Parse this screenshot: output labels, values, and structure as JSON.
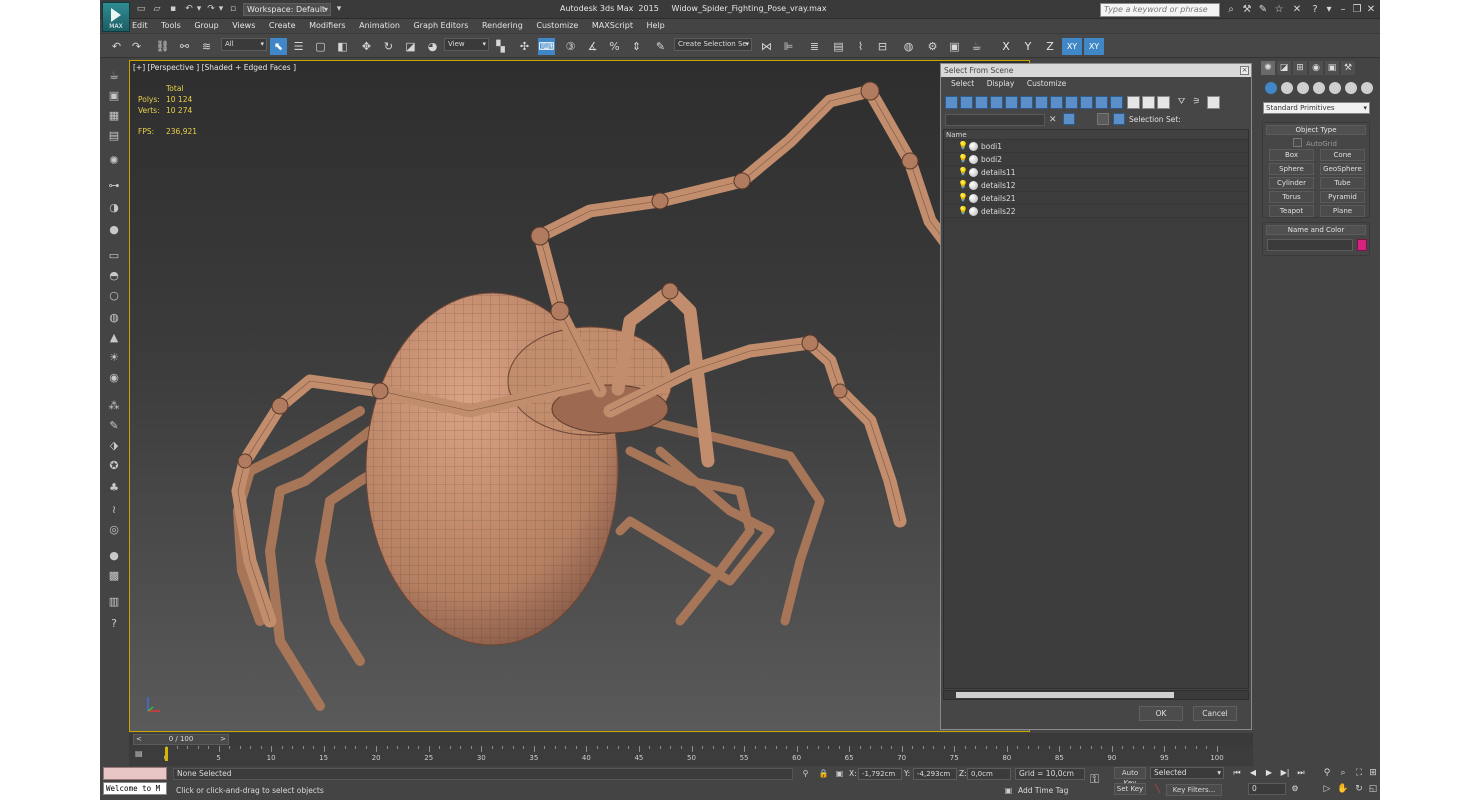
{
  "title_bar": {
    "workspace": "Workspace: Default",
    "app_title": "Autodesk 3ds Max  2015     Widow_Spider_Fighting_Pose_vray.max",
    "search_placeholder": "Type a keyword or phrase",
    "logo_text": "MAX"
  },
  "menu": [
    "Edit",
    "Tools",
    "Group",
    "Views",
    "Create",
    "Modifiers",
    "Animation",
    "Graph Editors",
    "Rendering",
    "Customize",
    "MAXScript",
    "Help"
  ],
  "toolbar": {
    "filter_dropdown": "All",
    "ref_coord_dropdown": "View",
    "selection_set_dropdown": "Create Selection Se",
    "axis_x": "X",
    "axis_y": "Y",
    "axis_z": "Z",
    "axis_xy": "XY",
    "axis_xy2": "XY"
  },
  "viewport": {
    "label": "[+] [Perspective ] [Shaded + Edged Faces ]",
    "stats_header": "Total",
    "polys_label": "Polys:",
    "polys_value": "10 124",
    "verts_label": "Verts:",
    "verts_value": "10 274",
    "fps_label": "FPS:",
    "fps_value": "236,921",
    "colors": {
      "mesh": "#c8906f",
      "wire": "#4a3023",
      "active_border": "#c8a400"
    }
  },
  "select_from_scene": {
    "title": "Select From Scene",
    "menu": [
      "Select",
      "Display",
      "Customize"
    ],
    "selection_set_label": "Selection Set:",
    "column_name": "Name",
    "objects": [
      "bodi1",
      "bodi2",
      "details11",
      "details12",
      "details21",
      "details22"
    ],
    "ok": "OK",
    "cancel": "Cancel"
  },
  "command_panel": {
    "category_dropdown": "Standard Primitives",
    "object_type_title": "Object Type",
    "autogrid": "AutoGrid",
    "primitives": [
      "Box",
      "Cone",
      "Sphere",
      "GeoSphere",
      "Cylinder",
      "Tube",
      "Torus",
      "Pyramid",
      "Teapot",
      "Plane"
    ],
    "name_color_title": "Name and Color",
    "object_color": "#d6237f"
  },
  "timeline": {
    "slider_label": "0 / 100",
    "ticks": [
      0,
      5,
      10,
      15,
      20,
      25,
      30,
      35,
      40,
      45,
      50,
      55,
      60,
      65,
      70,
      75,
      80,
      85,
      90,
      95,
      100
    ],
    "current_frame": 0
  },
  "status": {
    "maxscript_text": "Welcome to M",
    "selection_status": "None Selected",
    "prompt": "Click or click-and-drag to select objects",
    "x_label": "X:",
    "x_value": "-1,792cm",
    "y_label": "Y:",
    "y_value": "-4,293cm",
    "z_label": "Z:",
    "z_value": "0,0cm",
    "grid": "Grid = 10,0cm",
    "add_time_tag": "Add Time Tag",
    "auto_key": "Auto Key",
    "set_key": "Set Key",
    "selected_dropdown": "Selected",
    "key_filters": "Key Filters...",
    "frame_field": "0"
  }
}
